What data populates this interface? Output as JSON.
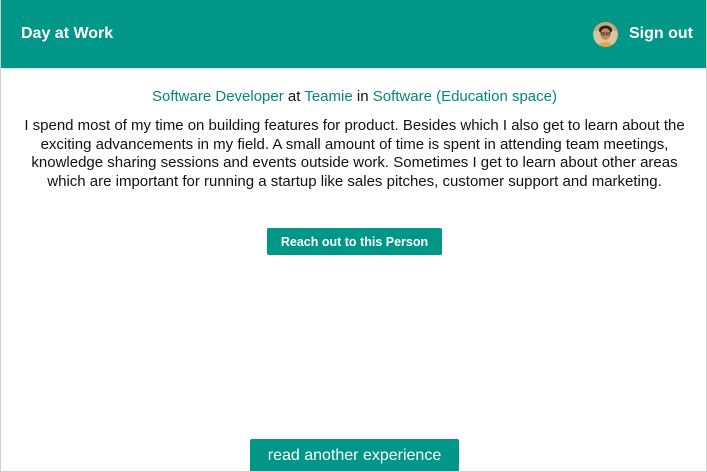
{
  "header": {
    "brand": "Day at Work",
    "signout_label": "Sign out",
    "avatar_icon": "user-avatar-photo",
    "background_color": "#009688"
  },
  "experience": {
    "role": "Software Developer",
    "at_word": "at",
    "company": "Teamie",
    "in_word": "in",
    "industry": "Software (Education space)",
    "description": "I spend most of my time on building features for product. Besides which I also get to learn about the exciting advancements in my field. A small amount of time is spent in attending team meetings, knowledge sharing sessions and events outside work. Sometimes I get to learn about other areas which are important for running a startup like sales pitches, customer support and marketing.",
    "reach_button_label": "Reach out to this Person"
  },
  "footer": {
    "read_another_label": "read another experience"
  },
  "colors": {
    "accent": "#009688",
    "link": "#00897b",
    "text": "#111111"
  }
}
